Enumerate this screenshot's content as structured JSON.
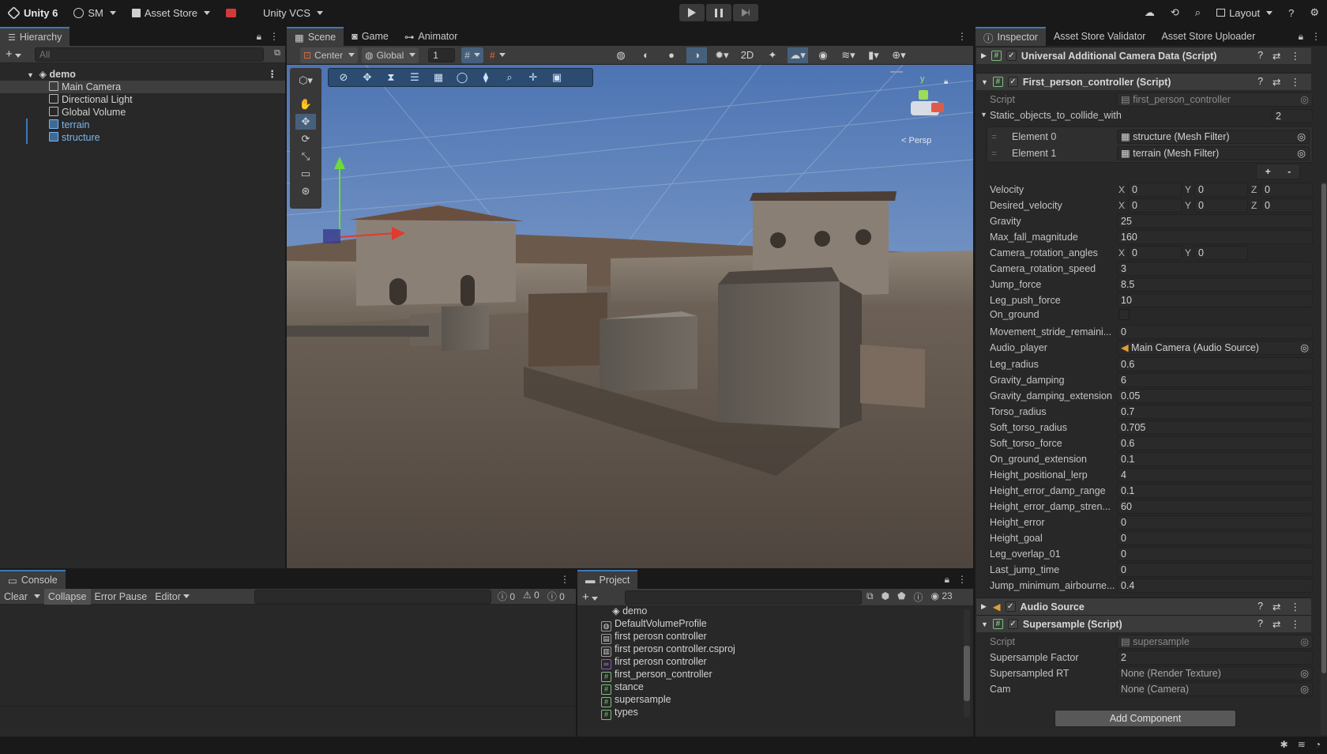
{
  "topbar": {
    "app": "Unity 6",
    "account": "SM",
    "store": "Asset Store",
    "vcs": "Unity VCS",
    "layout": "Layout"
  },
  "hierarchy": {
    "tab": "Hierarchy",
    "search_placeholder": "All",
    "scene": "demo",
    "items": [
      "Main Camera",
      "Directional Light",
      "Global Volume",
      "terrain",
      "structure"
    ]
  },
  "scene_tabs": {
    "scene": "Scene",
    "game": "Game",
    "animator": "Animator"
  },
  "scene_toolbar": {
    "pivot": "Center",
    "space": "Global",
    "snap": "1"
  },
  "scene_view": {
    "gizmo_axis": "y",
    "projection": "< Persp"
  },
  "inspector": {
    "tabs": [
      "Inspector",
      "Asset Store Validator",
      "Asset Store Uploader"
    ],
    "comp1": "Universal Additional Camera Data (Script)",
    "comp2": "First_person_controller (Script)",
    "script_label": "Script",
    "script_value": "first_person_controller",
    "list_label": "Static_objects_to_collide_with",
    "list_count": "2",
    "elements": [
      {
        "label": "Element 0",
        "value": "structure (Mesh Filter)"
      },
      {
        "label": "Element 1",
        "value": "terrain (Mesh Filter)"
      }
    ],
    "plus": "+",
    "minus": "-",
    "velocity": {
      "label": "Velocity",
      "x": "0",
      "y": "0",
      "z": "0"
    },
    "desired_velocity": {
      "label": "Desired_velocity",
      "x": "0",
      "y": "0",
      "z": "0"
    },
    "camera_rotation_angles": {
      "label": "Camera_rotation_angles",
      "x": "0",
      "y": "0"
    },
    "axis_x": "X",
    "axis_y": "Y",
    "axis_z": "Z",
    "props_a": [
      {
        "label": "Gravity",
        "value": "25"
      },
      {
        "label": "Max_fall_magnitude",
        "value": "160"
      }
    ],
    "props_b": [
      {
        "label": "Camera_rotation_speed",
        "value": "3"
      },
      {
        "label": "Jump_force",
        "value": "8.5"
      },
      {
        "label": "Leg_push_force",
        "value": "10"
      }
    ],
    "on_ground": "On_ground",
    "movement_stride": {
      "label": "Movement_stride_remaini...",
      "value": "0"
    },
    "audio_player": {
      "label": "Audio_player",
      "value": "Main Camera (Audio Source)"
    },
    "props_c": [
      {
        "label": "Leg_radius",
        "value": "0.6"
      },
      {
        "label": "Gravity_damping",
        "value": "6"
      },
      {
        "label": "Gravity_damping_extension",
        "value": "0.05"
      },
      {
        "label": "Torso_radius",
        "value": "0.7"
      },
      {
        "label": "Soft_torso_radius",
        "value": "0.705"
      },
      {
        "label": "Soft_torso_force",
        "value": "0.6"
      },
      {
        "label": "On_ground_extension",
        "value": "0.1"
      },
      {
        "label": "Height_positional_lerp",
        "value": "4"
      },
      {
        "label": "Height_error_damp_range",
        "value": "0.1"
      },
      {
        "label": "Height_error_damp_stren...",
        "value": "60"
      },
      {
        "label": "Height_error",
        "value": "0"
      },
      {
        "label": "Height_goal",
        "value": "0"
      },
      {
        "label": "Leg_overlap_01",
        "value": "0"
      },
      {
        "label": "Last_jump_time",
        "value": "0"
      },
      {
        "label": "Jump_minimum_airbourne...",
        "value": "0.4"
      }
    ],
    "comp3": "Audio Source",
    "comp4": "Supersample (Script)",
    "ss_script_value": "supersample",
    "ss_props": [
      {
        "label": "Supersample Factor",
        "value": "2"
      },
      {
        "label": "Supersampled RT",
        "value": "None (Render Texture)"
      },
      {
        "label": "Cam",
        "value": "None (Camera)"
      }
    ],
    "add_component": "Add Component"
  },
  "console": {
    "tab": "Console",
    "clear": "Clear",
    "collapse": "Collapse",
    "error_pause": "Error Pause",
    "editor": "Editor",
    "count_info": "0",
    "count_warn": "0",
    "count_error": "0"
  },
  "project": {
    "tab": "Project",
    "plus": "+",
    "count": "23",
    "items": [
      "demo",
      "DefaultVolumeProfile",
      "first perosn controller",
      "first perosn controller.csproj",
      "first perosn controller",
      "first_person_controller",
      "stance",
      "supersample",
      "types"
    ]
  }
}
